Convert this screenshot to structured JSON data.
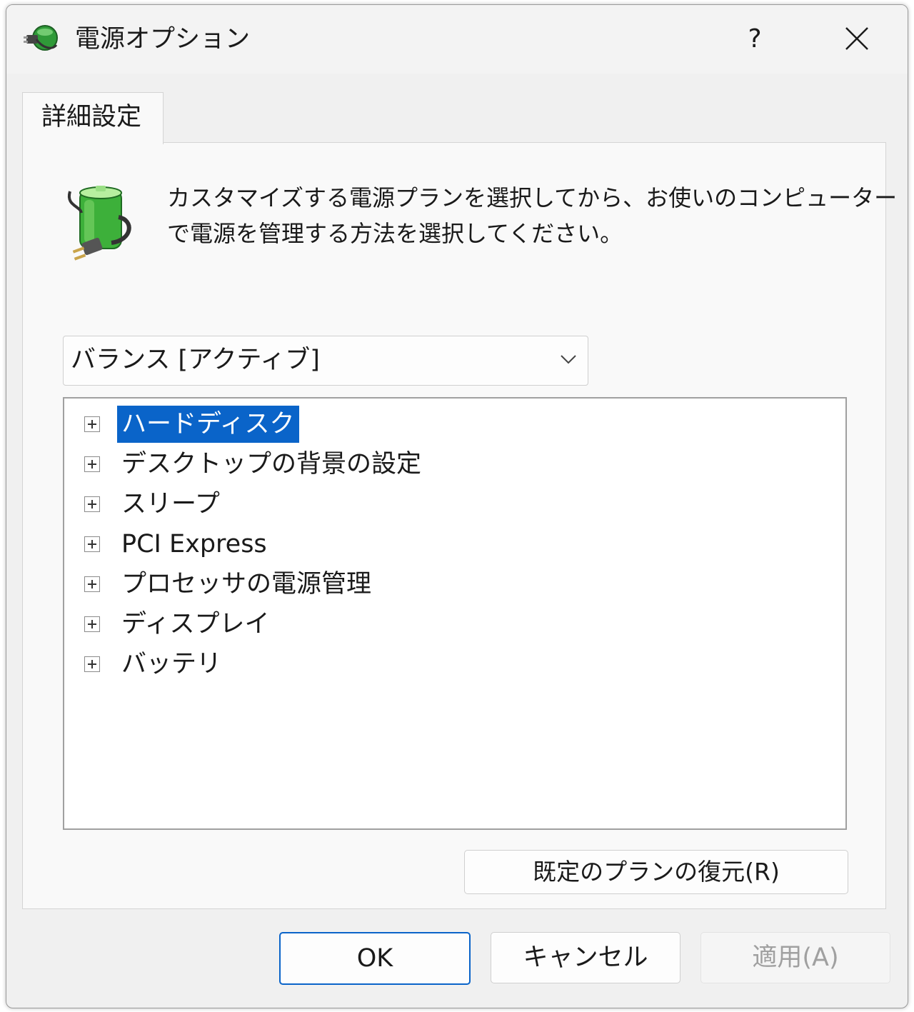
{
  "window": {
    "title": "電源オプション",
    "help_label": "?",
    "icons": {
      "app": "power-plug-icon",
      "close": "close-icon"
    }
  },
  "tab": {
    "label": "詳細設定"
  },
  "description": {
    "line1": "カスタマイズする電源プランを選択してから、お使いのコンピューター",
    "line2": "で電源を管理する方法を選択してください。",
    "icon": "battery-plug-icon"
  },
  "plan_select": {
    "value": "バランス [アクティブ]",
    "icon": "chevron-down-icon"
  },
  "tree": {
    "items": [
      {
        "label": "ハードディスク",
        "selected": true
      },
      {
        "label": "デスクトップの背景の設定",
        "selected": false
      },
      {
        "label": "スリープ",
        "selected": false
      },
      {
        "label": "PCI Express",
        "selected": false
      },
      {
        "label": "プロセッサの電源管理",
        "selected": false
      },
      {
        "label": "ディスプレイ",
        "selected": false
      },
      {
        "label": "バッテリ",
        "selected": false
      }
    ],
    "expander_icon": "plus-box-icon"
  },
  "buttons": {
    "restore": "既定のプランの復元(R)",
    "ok": "OK",
    "cancel": "キャンセル",
    "apply": "適用(A)"
  },
  "colors": {
    "selection": "#0a64c9",
    "window_bg": "#f0f0f0",
    "panel_bg": "#f9f9f9",
    "disabled_text": "#a0a0a0",
    "battery_green": "#3db03a"
  }
}
